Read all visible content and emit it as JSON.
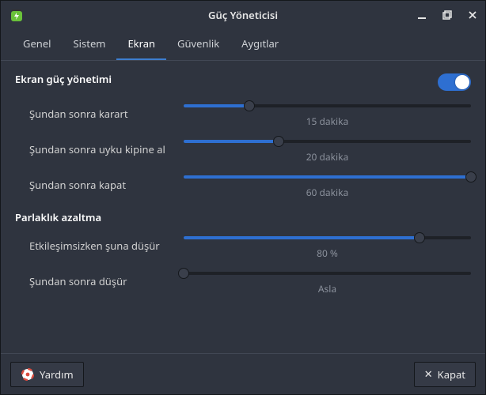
{
  "window": {
    "title": "Güç Yöneticisi"
  },
  "tabs": {
    "t0": "Genel",
    "t1": "Sistem",
    "t2": "Ekran",
    "t3": "Güvenlik",
    "t4": "Aygıtlar",
    "active_index": 2
  },
  "section_display": {
    "title": "Ekran güç yönetimi",
    "toggle_on": true,
    "rows": {
      "blank": {
        "label": "Şundan sonra karart",
        "value_text": "15 dakika",
        "fill_pct": 23
      },
      "sleep": {
        "label": "Şundan sonra uyku kipine al",
        "value_text": "20 dakika",
        "fill_pct": 33
      },
      "off": {
        "label": "Şundan sonra kapat",
        "value_text": "60 dakika",
        "fill_pct": 100
      }
    }
  },
  "section_brightness": {
    "title": "Parlaklık azaltma",
    "rows": {
      "reduce_to": {
        "label": "Etkileşimsizken şuna düşür",
        "value_text": "80 %",
        "fill_pct": 82
      },
      "after": {
        "label": "Şundan sonra düşür",
        "value_text": "Asla",
        "fill_pct": 0
      }
    }
  },
  "footer": {
    "help_label": "Yardım",
    "close_label": "Kapat"
  }
}
